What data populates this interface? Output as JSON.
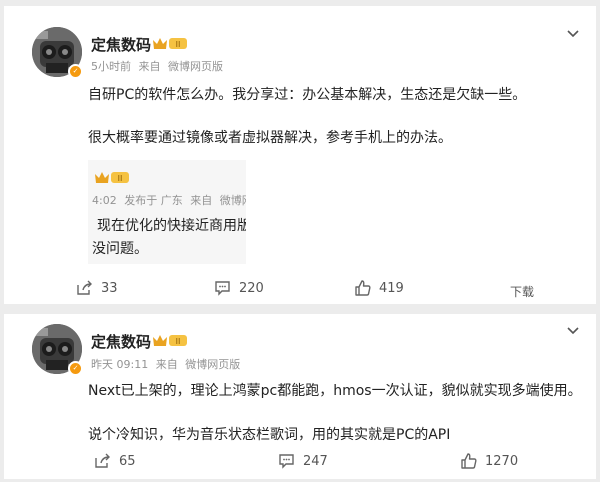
{
  "posts": [
    {
      "author": "定焦数码",
      "level_badge": "II",
      "meta": {
        "time": "5小时前",
        "source_prefix": "来自",
        "source": "微博网页版"
      },
      "paragraphs": [
        "自研PC的软件怎么办。我分享过：办公基本解决，生态还是欠缺一些。",
        "很大概率要通过镜像或者虚拟器解决，参考手机上的办法。"
      ],
      "repost": {
        "level_badge": "II",
        "meta": {
          "time": "4:02",
          "location": "发布于 广东",
          "source_prefix": "来自",
          "source": "微博网"
        },
        "lines": [
          "现在优化的快接近商用版",
          "没问题。"
        ]
      },
      "actions": {
        "share": "33",
        "comment": "220",
        "like": "419",
        "download": "下载"
      }
    },
    {
      "author": "定焦数码",
      "level_badge": "II",
      "meta": {
        "time": "昨天 09:11",
        "source_prefix": "来自",
        "source": "微博网页版"
      },
      "paragraphs": [
        "Next已上架的，理论上鸿蒙pc都能跑，hmos一次认证，貌似就实现多端使用。",
        "说个冷知识，华为音乐状态栏歌词，用的其实就是PC的API"
      ],
      "actions": {
        "share": "65",
        "comment": "247",
        "like": "1270"
      }
    }
  ],
  "colors": {
    "accent_gold": "#f59a0f",
    "meta_gray": "#939393",
    "card_bg": "#ffffff",
    "page_bg": "#ececec"
  },
  "icons": [
    "avatar",
    "verified-badge-icon",
    "crown-badge-icon",
    "chevron-down-icon",
    "share-icon",
    "comment-icon",
    "like-icon"
  ]
}
